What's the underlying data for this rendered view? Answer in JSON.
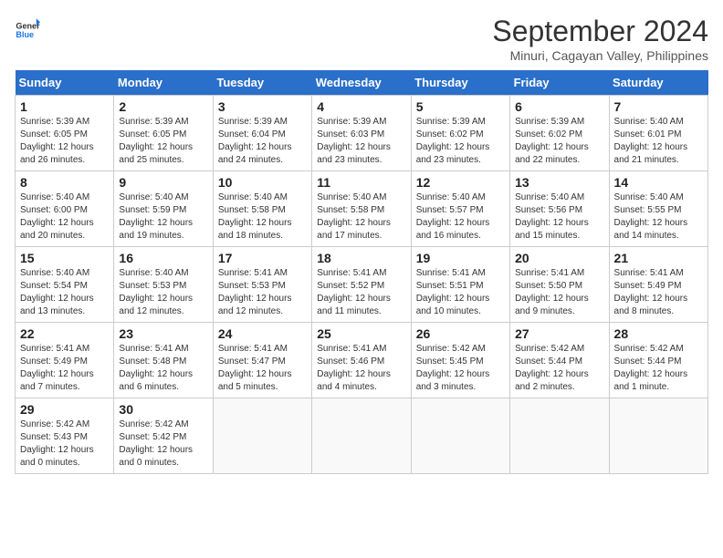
{
  "header": {
    "logo_line1": "General",
    "logo_line2": "Blue",
    "month_title": "September 2024",
    "subtitle": "Minuri, Cagayan Valley, Philippines"
  },
  "weekdays": [
    "Sunday",
    "Monday",
    "Tuesday",
    "Wednesday",
    "Thursday",
    "Friday",
    "Saturday"
  ],
  "weeks": [
    [
      {
        "day": "1",
        "info": "Sunrise: 5:39 AM\nSunset: 6:05 PM\nDaylight: 12 hours\nand 26 minutes."
      },
      {
        "day": "2",
        "info": "Sunrise: 5:39 AM\nSunset: 6:05 PM\nDaylight: 12 hours\nand 25 minutes."
      },
      {
        "day": "3",
        "info": "Sunrise: 5:39 AM\nSunset: 6:04 PM\nDaylight: 12 hours\nand 24 minutes."
      },
      {
        "day": "4",
        "info": "Sunrise: 5:39 AM\nSunset: 6:03 PM\nDaylight: 12 hours\nand 23 minutes."
      },
      {
        "day": "5",
        "info": "Sunrise: 5:39 AM\nSunset: 6:02 PM\nDaylight: 12 hours\nand 23 minutes."
      },
      {
        "day": "6",
        "info": "Sunrise: 5:39 AM\nSunset: 6:02 PM\nDaylight: 12 hours\nand 22 minutes."
      },
      {
        "day": "7",
        "info": "Sunrise: 5:40 AM\nSunset: 6:01 PM\nDaylight: 12 hours\nand 21 minutes."
      }
    ],
    [
      {
        "day": "8",
        "info": "Sunrise: 5:40 AM\nSunset: 6:00 PM\nDaylight: 12 hours\nand 20 minutes."
      },
      {
        "day": "9",
        "info": "Sunrise: 5:40 AM\nSunset: 5:59 PM\nDaylight: 12 hours\nand 19 minutes."
      },
      {
        "day": "10",
        "info": "Sunrise: 5:40 AM\nSunset: 5:58 PM\nDaylight: 12 hours\nand 18 minutes."
      },
      {
        "day": "11",
        "info": "Sunrise: 5:40 AM\nSunset: 5:58 PM\nDaylight: 12 hours\nand 17 minutes."
      },
      {
        "day": "12",
        "info": "Sunrise: 5:40 AM\nSunset: 5:57 PM\nDaylight: 12 hours\nand 16 minutes."
      },
      {
        "day": "13",
        "info": "Sunrise: 5:40 AM\nSunset: 5:56 PM\nDaylight: 12 hours\nand 15 minutes."
      },
      {
        "day": "14",
        "info": "Sunrise: 5:40 AM\nSunset: 5:55 PM\nDaylight: 12 hours\nand 14 minutes."
      }
    ],
    [
      {
        "day": "15",
        "info": "Sunrise: 5:40 AM\nSunset: 5:54 PM\nDaylight: 12 hours\nand 13 minutes."
      },
      {
        "day": "16",
        "info": "Sunrise: 5:40 AM\nSunset: 5:53 PM\nDaylight: 12 hours\nand 12 minutes."
      },
      {
        "day": "17",
        "info": "Sunrise: 5:41 AM\nSunset: 5:53 PM\nDaylight: 12 hours\nand 12 minutes."
      },
      {
        "day": "18",
        "info": "Sunrise: 5:41 AM\nSunset: 5:52 PM\nDaylight: 12 hours\nand 11 minutes."
      },
      {
        "day": "19",
        "info": "Sunrise: 5:41 AM\nSunset: 5:51 PM\nDaylight: 12 hours\nand 10 minutes."
      },
      {
        "day": "20",
        "info": "Sunrise: 5:41 AM\nSunset: 5:50 PM\nDaylight: 12 hours\nand 9 minutes."
      },
      {
        "day": "21",
        "info": "Sunrise: 5:41 AM\nSunset: 5:49 PM\nDaylight: 12 hours\nand 8 minutes."
      }
    ],
    [
      {
        "day": "22",
        "info": "Sunrise: 5:41 AM\nSunset: 5:49 PM\nDaylight: 12 hours\nand 7 minutes."
      },
      {
        "day": "23",
        "info": "Sunrise: 5:41 AM\nSunset: 5:48 PM\nDaylight: 12 hours\nand 6 minutes."
      },
      {
        "day": "24",
        "info": "Sunrise: 5:41 AM\nSunset: 5:47 PM\nDaylight: 12 hours\nand 5 minutes."
      },
      {
        "day": "25",
        "info": "Sunrise: 5:41 AM\nSunset: 5:46 PM\nDaylight: 12 hours\nand 4 minutes."
      },
      {
        "day": "26",
        "info": "Sunrise: 5:42 AM\nSunset: 5:45 PM\nDaylight: 12 hours\nand 3 minutes."
      },
      {
        "day": "27",
        "info": "Sunrise: 5:42 AM\nSunset: 5:44 PM\nDaylight: 12 hours\nand 2 minutes."
      },
      {
        "day": "28",
        "info": "Sunrise: 5:42 AM\nSunset: 5:44 PM\nDaylight: 12 hours\nand 1 minute."
      }
    ],
    [
      {
        "day": "29",
        "info": "Sunrise: 5:42 AM\nSunset: 5:43 PM\nDaylight: 12 hours\nand 0 minutes."
      },
      {
        "day": "30",
        "info": "Sunrise: 5:42 AM\nSunset: 5:42 PM\nDaylight: 12 hours\nand 0 minutes."
      },
      {
        "day": "",
        "info": ""
      },
      {
        "day": "",
        "info": ""
      },
      {
        "day": "",
        "info": ""
      },
      {
        "day": "",
        "info": ""
      },
      {
        "day": "",
        "info": ""
      }
    ]
  ]
}
